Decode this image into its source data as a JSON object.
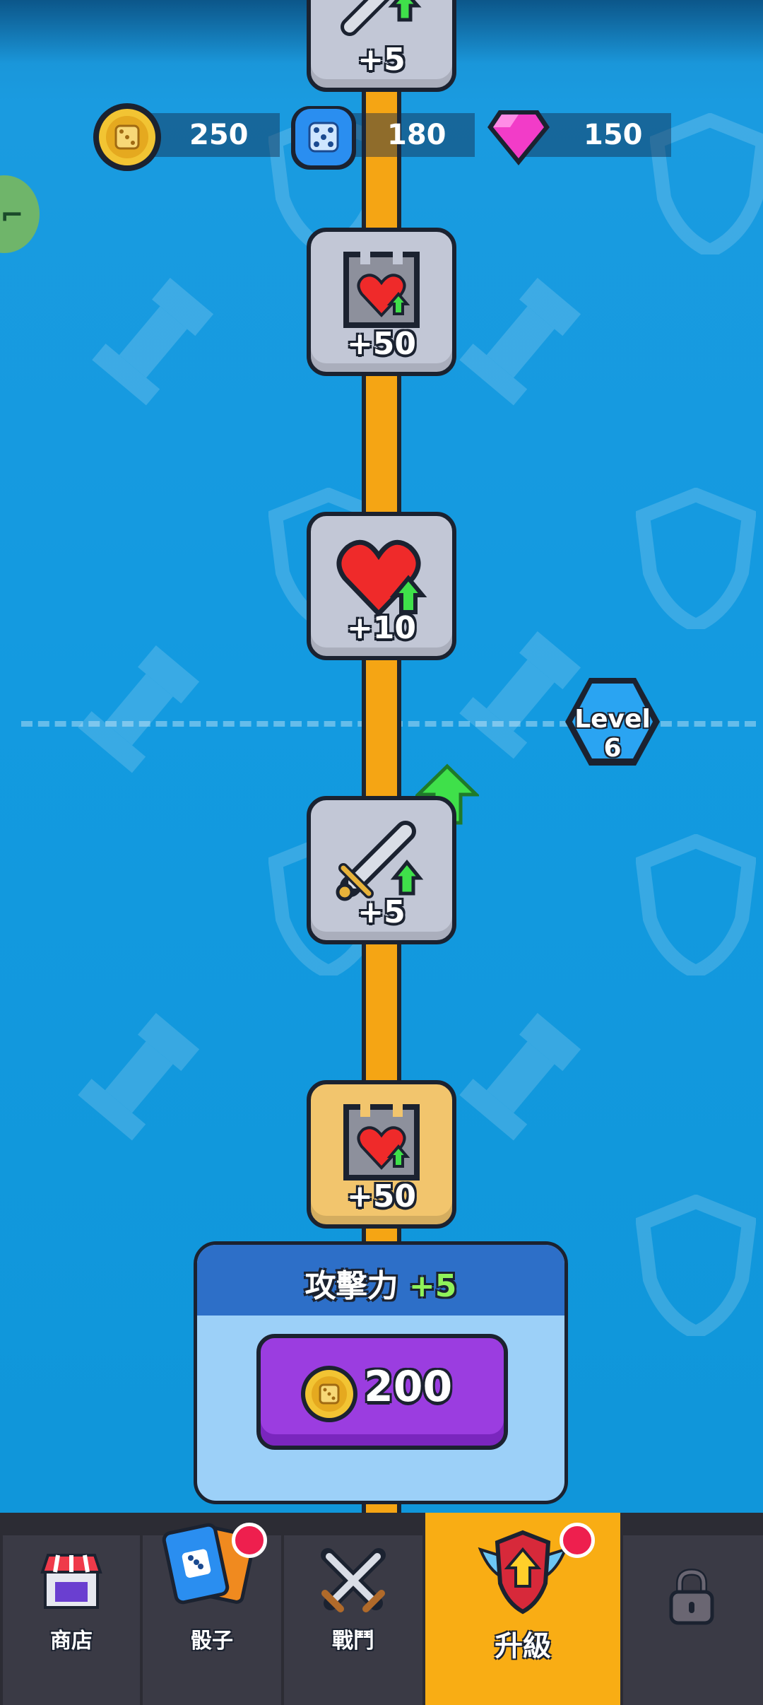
{
  "resources": {
    "coins": "250",
    "dice": "180",
    "gems": "150"
  },
  "track": {
    "nodes": [
      {
        "icon": "sword-upgrade-icon",
        "value": "+5"
      },
      {
        "icon": "tower-heart-icon",
        "value": "+50"
      },
      {
        "icon": "heart-upgrade-icon",
        "value": "+10"
      },
      {
        "icon": "sword-upgrade-icon",
        "value": "+5"
      },
      {
        "icon": "tower-heart-icon",
        "value": "+50"
      }
    ],
    "level_label": "Level 6"
  },
  "upgrade_panel": {
    "stat_name": "攻擊力",
    "stat_bonus": "+5",
    "cost": "200"
  },
  "nav": {
    "items": [
      {
        "label": "商店",
        "icon": "shop-icon"
      },
      {
        "label": "骰子",
        "icon": "dice-cards-icon"
      },
      {
        "label": "戰鬥",
        "icon": "crossed-swords-icon"
      },
      {
        "label": "升級",
        "icon": "upgrade-shield-icon"
      },
      {
        "label": "",
        "icon": "lock-icon"
      }
    ]
  },
  "colors": {
    "background": "#1596d8",
    "path": "#f5a514",
    "buy_button": "#9b3de0",
    "nav_active": "#f9ad14",
    "badge": "#ee1f4e"
  }
}
